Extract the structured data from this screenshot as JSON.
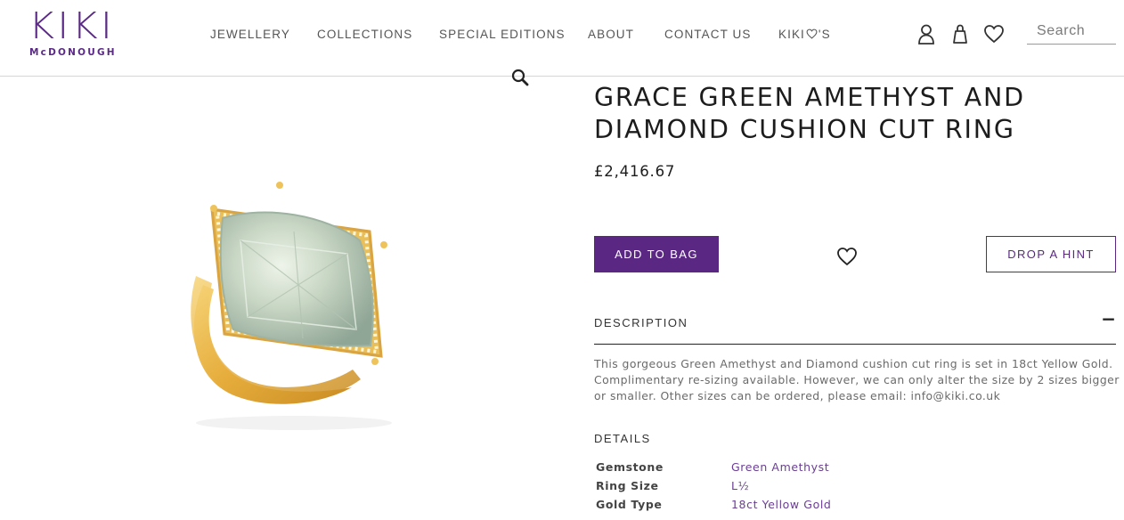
{
  "brand": {
    "name": "KIKI",
    "sub": "McDONOUGH",
    "color": "#5b2a86"
  },
  "nav": {
    "items": [
      {
        "label": "JEWELLERY"
      },
      {
        "label": "COLLECTIONS"
      },
      {
        "label": "SPECIAL EDITIONS"
      },
      {
        "label": "ABOUT"
      },
      {
        "label": "CONTACT US"
      }
    ],
    "kiki_loves": {
      "prefix": "KIKI",
      "icon": "heart-icon",
      "suffix": "'S"
    }
  },
  "header_icons": [
    "user-icon",
    "shopping-bag-icon",
    "heart-icon"
  ],
  "search": {
    "placeholder": "Search",
    "value": ""
  },
  "gallery": {
    "zoom_icon": "magnifier-icon"
  },
  "product": {
    "title": "GRACE GREEN AMETHYST AND DIAMOND CUSHION CUT RING",
    "price": "£2,416.67",
    "add_to_bag_label": "ADD TO BAG",
    "wishlist_icon": "heart-icon",
    "drop_hint_label": "DROP A HINT",
    "description_heading": "DESCRIPTION",
    "description_toggle": "−",
    "description_text": "This gorgeous Green Amethyst and Diamond cushion cut ring is set in 18ct Yellow Gold. Complimentary re-sizing available. However, we can only alter the size by 2 sizes bigger or smaller. Other sizes can be ordered, please email: ",
    "description_email": "info@kiki.co.uk",
    "details_heading": "DETAILS",
    "details": [
      {
        "key": "Gemstone",
        "value": "Green Amethyst"
      },
      {
        "key": "Ring Size",
        "value": "L½"
      },
      {
        "key": "Gold Type",
        "value": "18ct Yellow Gold"
      }
    ]
  },
  "colors": {
    "accent": "#5a2883",
    "text": "#1c1c1c",
    "muted": "#6a6a6a"
  }
}
